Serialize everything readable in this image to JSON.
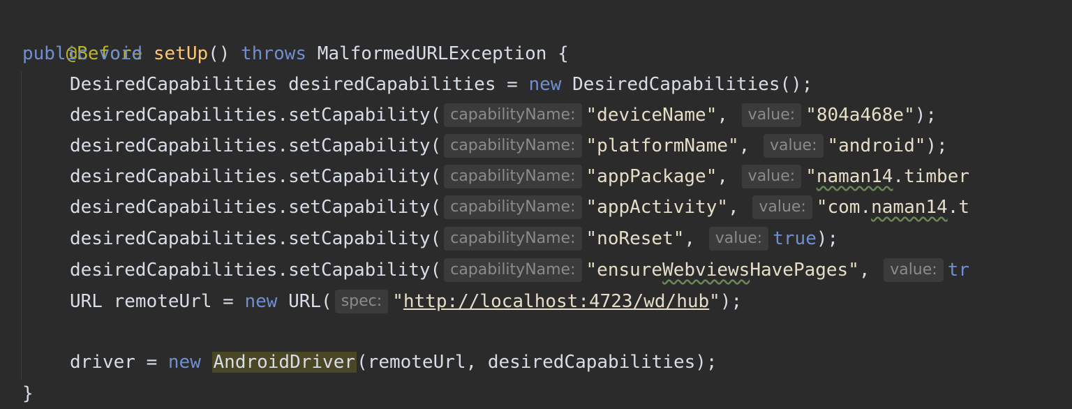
{
  "code": {
    "l1": {
      "annotation": "@Before"
    },
    "l2": {
      "kw_public": "public",
      "kw_void": "void",
      "method": "setUp",
      "parens": "()",
      "kw_throws": "throws",
      "exception": "MalformedURLException",
      "brace": " {"
    },
    "l3": {
      "type": "DesiredCapabilities",
      "decl": " desiredCapabilities = ",
      "kw_new": "new",
      "ctor": " DesiredCapabilities();"
    },
    "call_prefix": "desiredCapabilities.setCapability(",
    "hint_name": "capabilityName:",
    "hint_value": "value:",
    "caps": [
      {
        "name": "\"deviceName\"",
        "comma": ", ",
        "value": "\"804a468e\"",
        "end": ");"
      },
      {
        "name": "\"platformName\"",
        "comma": ", ",
        "value": "\"android\"",
        "end": ");"
      },
      {
        "name": "\"appPackage\"",
        "comma": ", ",
        "value_a": "\"",
        "value_b": "naman14",
        "value_c": ".timber"
      },
      {
        "name": "\"appActivity\"",
        "comma": ", ",
        "value_a": "\"com.",
        "value_b": "naman14",
        "value_c": ".t"
      },
      {
        "name": "\"noReset\"",
        "comma": ", ",
        "value": "true",
        "end": ");"
      },
      {
        "name_a": "\"ensure",
        "name_b": "Webviews",
        "name_c": "HavePages\"",
        "comma": ", ",
        "value": "tr"
      }
    ],
    "url": {
      "type": "URL",
      "decl": " remoteUrl = ",
      "kw_new": "new",
      "ctor": " URL(",
      "hint": "spec:",
      "q1": "\"",
      "link": "http://localhost:4723/wd/hub",
      "q2": "\"",
      "end": ");"
    },
    "driver": {
      "var": "driver",
      "eq": " = ",
      "kw_new": "new",
      "cls": "AndroidDriver",
      "args": "(remoteUrl, desiredCapabilities);"
    },
    "close": "}"
  }
}
